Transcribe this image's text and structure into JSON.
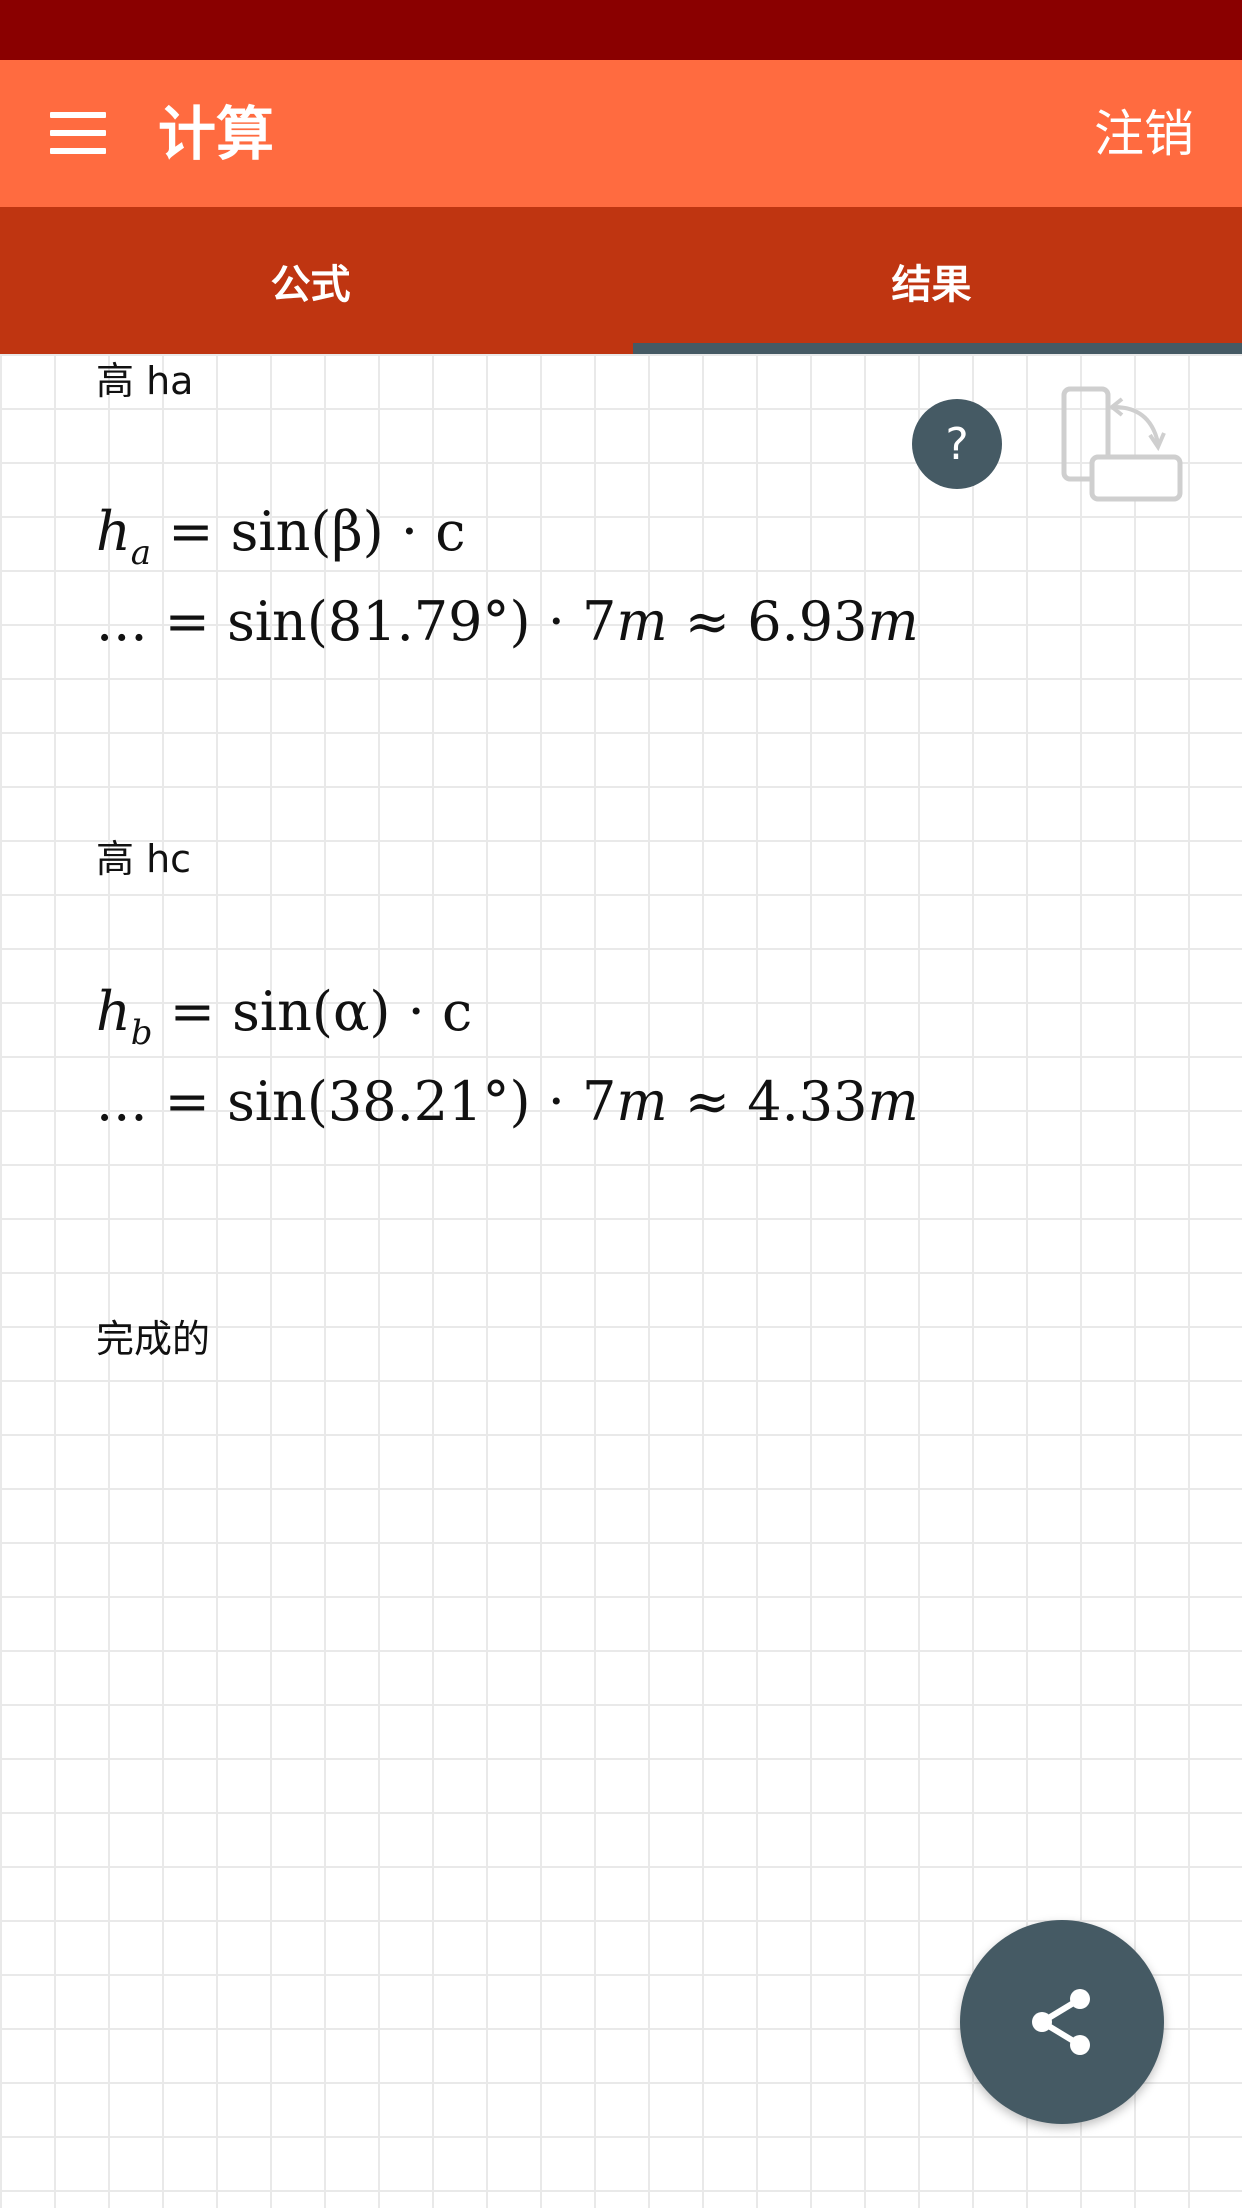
{
  "app_bar": {
    "title": "计算",
    "logout_label": "注销"
  },
  "tabs": [
    {
      "label": "公式",
      "selected": false
    },
    {
      "label": "结果",
      "selected": true
    }
  ],
  "help": {
    "label": "?"
  },
  "sections": [
    {
      "label": "高 ha",
      "formula_var": "h",
      "formula_sub": "a",
      "formula_rhs": " = sin(β) · c",
      "calc_prefix": "... = sin(81.79°) · 7",
      "calc_unit1": "m",
      "calc_approx": " ≈ 6.93",
      "calc_unit2": "m"
    },
    {
      "label": "高 hc",
      "formula_var": "h",
      "formula_sub": "b",
      "formula_rhs": " = sin(α) · c",
      "calc_prefix": "... = sin(38.21°) · 7",
      "calc_unit1": "m",
      "calc_approx": " ≈ 4.33",
      "calc_unit2": "m"
    }
  ],
  "done_label": "完成的",
  "colors": {
    "status_bar": "#8a0000",
    "app_bar": "#ff6b40",
    "tab_bar": "#bf3511",
    "accent": "#455a64"
  },
  "icons": {
    "menu": "menu-icon",
    "rotate": "rotate-screen-icon",
    "share": "share-icon"
  }
}
